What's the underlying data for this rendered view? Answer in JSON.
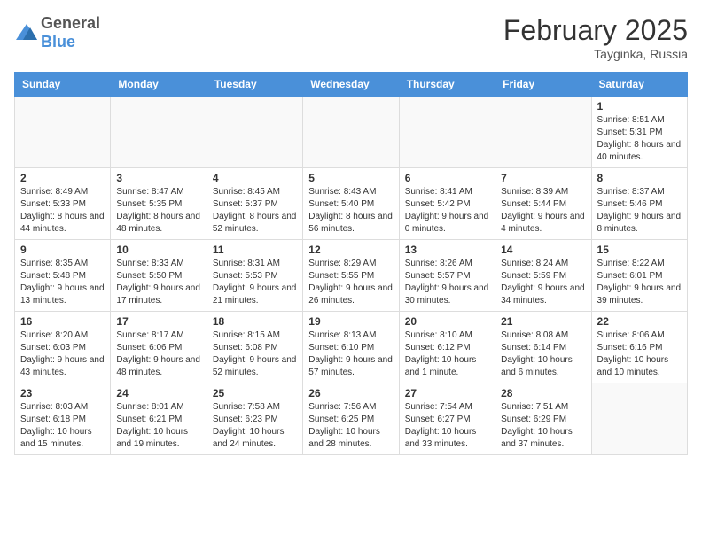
{
  "header": {
    "logo_general": "General",
    "logo_blue": "Blue",
    "month_year": "February 2025",
    "location": "Tayginka, Russia"
  },
  "weekdays": [
    "Sunday",
    "Monday",
    "Tuesday",
    "Wednesday",
    "Thursday",
    "Friday",
    "Saturday"
  ],
  "weeks": [
    [
      {
        "day": "",
        "info": ""
      },
      {
        "day": "",
        "info": ""
      },
      {
        "day": "",
        "info": ""
      },
      {
        "day": "",
        "info": ""
      },
      {
        "day": "",
        "info": ""
      },
      {
        "day": "",
        "info": ""
      },
      {
        "day": "1",
        "info": "Sunrise: 8:51 AM\nSunset: 5:31 PM\nDaylight: 8 hours and 40 minutes."
      }
    ],
    [
      {
        "day": "2",
        "info": "Sunrise: 8:49 AM\nSunset: 5:33 PM\nDaylight: 8 hours and 44 minutes."
      },
      {
        "day": "3",
        "info": "Sunrise: 8:47 AM\nSunset: 5:35 PM\nDaylight: 8 hours and 48 minutes."
      },
      {
        "day": "4",
        "info": "Sunrise: 8:45 AM\nSunset: 5:37 PM\nDaylight: 8 hours and 52 minutes."
      },
      {
        "day": "5",
        "info": "Sunrise: 8:43 AM\nSunset: 5:40 PM\nDaylight: 8 hours and 56 minutes."
      },
      {
        "day": "6",
        "info": "Sunrise: 8:41 AM\nSunset: 5:42 PM\nDaylight: 9 hours and 0 minutes."
      },
      {
        "day": "7",
        "info": "Sunrise: 8:39 AM\nSunset: 5:44 PM\nDaylight: 9 hours and 4 minutes."
      },
      {
        "day": "8",
        "info": "Sunrise: 8:37 AM\nSunset: 5:46 PM\nDaylight: 9 hours and 8 minutes."
      }
    ],
    [
      {
        "day": "9",
        "info": "Sunrise: 8:35 AM\nSunset: 5:48 PM\nDaylight: 9 hours and 13 minutes."
      },
      {
        "day": "10",
        "info": "Sunrise: 8:33 AM\nSunset: 5:50 PM\nDaylight: 9 hours and 17 minutes."
      },
      {
        "day": "11",
        "info": "Sunrise: 8:31 AM\nSunset: 5:53 PM\nDaylight: 9 hours and 21 minutes."
      },
      {
        "day": "12",
        "info": "Sunrise: 8:29 AM\nSunset: 5:55 PM\nDaylight: 9 hours and 26 minutes."
      },
      {
        "day": "13",
        "info": "Sunrise: 8:26 AM\nSunset: 5:57 PM\nDaylight: 9 hours and 30 minutes."
      },
      {
        "day": "14",
        "info": "Sunrise: 8:24 AM\nSunset: 5:59 PM\nDaylight: 9 hours and 34 minutes."
      },
      {
        "day": "15",
        "info": "Sunrise: 8:22 AM\nSunset: 6:01 PM\nDaylight: 9 hours and 39 minutes."
      }
    ],
    [
      {
        "day": "16",
        "info": "Sunrise: 8:20 AM\nSunset: 6:03 PM\nDaylight: 9 hours and 43 minutes."
      },
      {
        "day": "17",
        "info": "Sunrise: 8:17 AM\nSunset: 6:06 PM\nDaylight: 9 hours and 48 minutes."
      },
      {
        "day": "18",
        "info": "Sunrise: 8:15 AM\nSunset: 6:08 PM\nDaylight: 9 hours and 52 minutes."
      },
      {
        "day": "19",
        "info": "Sunrise: 8:13 AM\nSunset: 6:10 PM\nDaylight: 9 hours and 57 minutes."
      },
      {
        "day": "20",
        "info": "Sunrise: 8:10 AM\nSunset: 6:12 PM\nDaylight: 10 hours and 1 minute."
      },
      {
        "day": "21",
        "info": "Sunrise: 8:08 AM\nSunset: 6:14 PM\nDaylight: 10 hours and 6 minutes."
      },
      {
        "day": "22",
        "info": "Sunrise: 8:06 AM\nSunset: 6:16 PM\nDaylight: 10 hours and 10 minutes."
      }
    ],
    [
      {
        "day": "23",
        "info": "Sunrise: 8:03 AM\nSunset: 6:18 PM\nDaylight: 10 hours and 15 minutes."
      },
      {
        "day": "24",
        "info": "Sunrise: 8:01 AM\nSunset: 6:21 PM\nDaylight: 10 hours and 19 minutes."
      },
      {
        "day": "25",
        "info": "Sunrise: 7:58 AM\nSunset: 6:23 PM\nDaylight: 10 hours and 24 minutes."
      },
      {
        "day": "26",
        "info": "Sunrise: 7:56 AM\nSunset: 6:25 PM\nDaylight: 10 hours and 28 minutes."
      },
      {
        "day": "27",
        "info": "Sunrise: 7:54 AM\nSunset: 6:27 PM\nDaylight: 10 hours and 33 minutes."
      },
      {
        "day": "28",
        "info": "Sunrise: 7:51 AM\nSunset: 6:29 PM\nDaylight: 10 hours and 37 minutes."
      },
      {
        "day": "",
        "info": ""
      }
    ]
  ]
}
